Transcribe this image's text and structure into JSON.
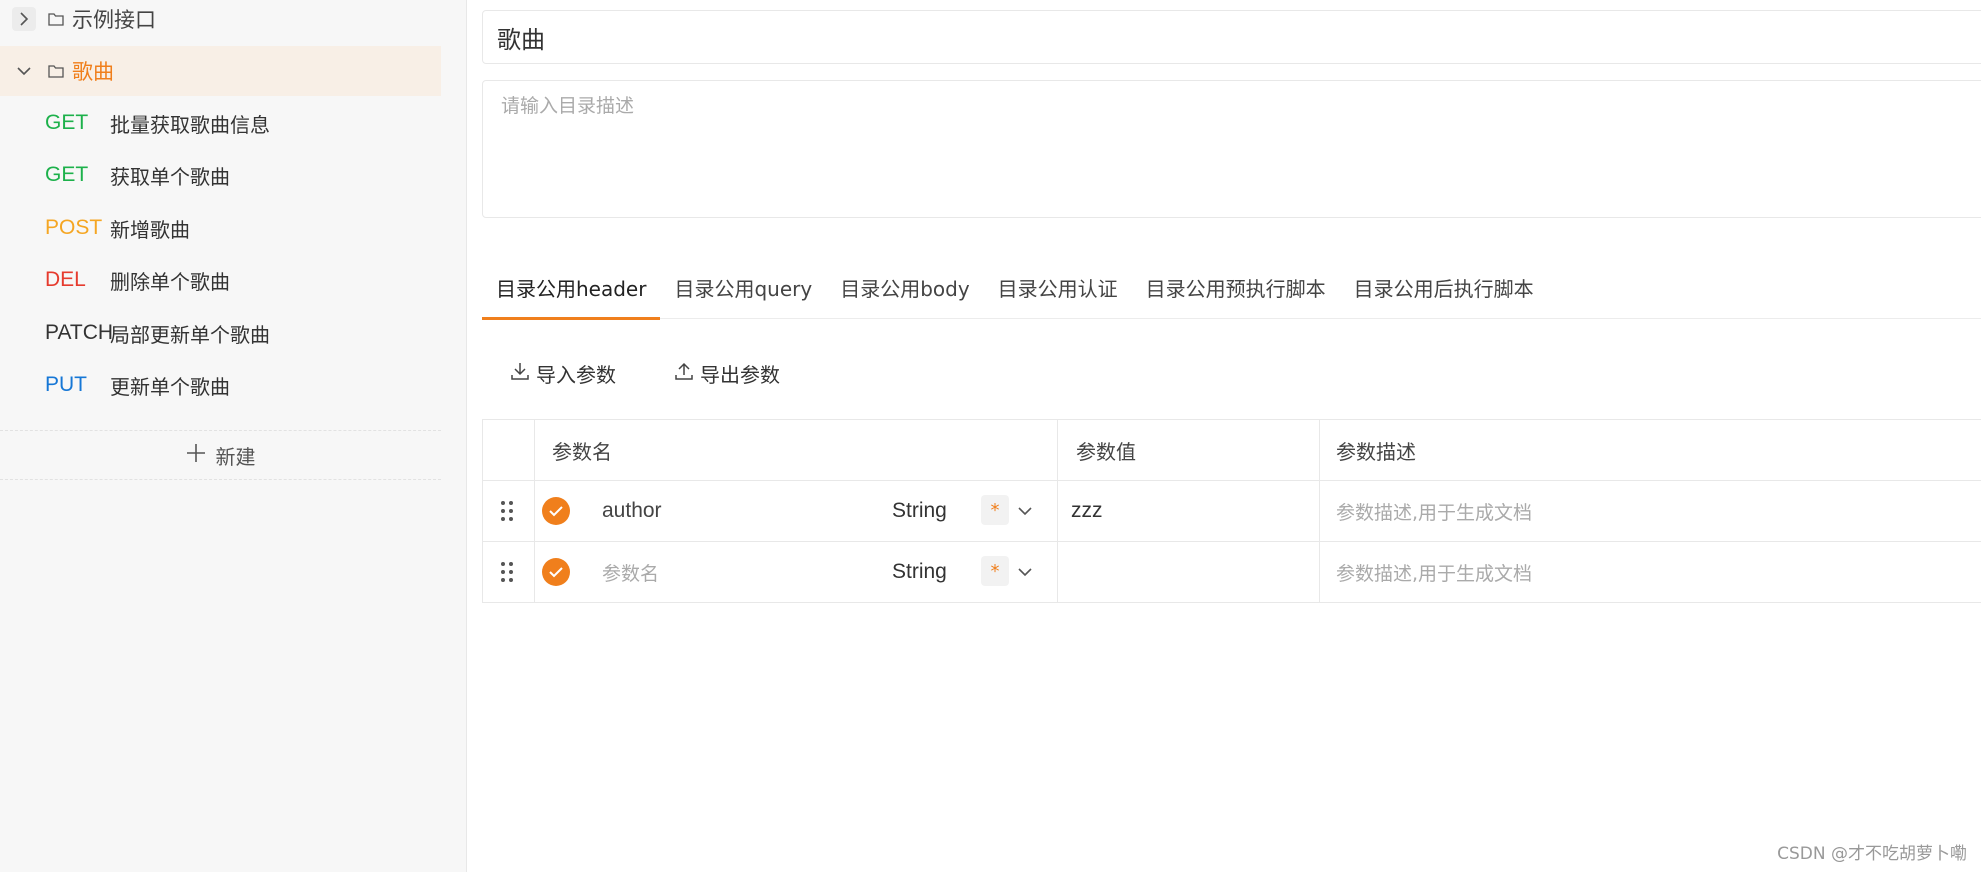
{
  "sidebar": {
    "folders": [
      {
        "label": "示例接口",
        "expanded": false
      },
      {
        "label": "歌曲",
        "expanded": true
      }
    ],
    "items": [
      {
        "method": "GET",
        "name": "批量获取歌曲信息"
      },
      {
        "method": "GET",
        "name": "获取单个歌曲"
      },
      {
        "method": "POST",
        "name": "新增歌曲"
      },
      {
        "method": "DEL",
        "name": "删除单个歌曲"
      },
      {
        "method": "PATCH",
        "name": "局部更新单个歌曲"
      },
      {
        "method": "PUT",
        "name": "更新单个歌曲"
      }
    ],
    "new_label": "新建"
  },
  "main": {
    "title": "歌曲",
    "desc_placeholder": "请输入目录描述",
    "tabs": [
      {
        "label": "目录公用header",
        "active": true
      },
      {
        "label": "目录公用query",
        "active": false
      },
      {
        "label": "目录公用body",
        "active": false
      },
      {
        "label": "目录公用认证",
        "active": false
      },
      {
        "label": "目录公用预执行脚本",
        "active": false
      },
      {
        "label": "目录公用后执行脚本",
        "active": false
      }
    ],
    "import_label": "导入参数",
    "export_label": "导出参数",
    "table": {
      "headers": [
        "参数名",
        "参数值",
        "参数描述"
      ],
      "rows": [
        {
          "name": "author",
          "name_is_placeholder": false,
          "type": "String",
          "required": "*",
          "value": "zzz",
          "desc_placeholder": "参数描述,用于生成文档"
        },
        {
          "name": "参数名",
          "name_is_placeholder": true,
          "type": "String",
          "required": "*",
          "value": "",
          "desc_placeholder": "参数描述,用于生成文档"
        }
      ]
    }
  },
  "watermark": "CSDN @才不吃胡萝卜嘞",
  "colors": {
    "accent": "#f07f1c",
    "get": "#1db14b",
    "post": "#f5a623",
    "del": "#e63b2e",
    "put": "#1677d6"
  }
}
